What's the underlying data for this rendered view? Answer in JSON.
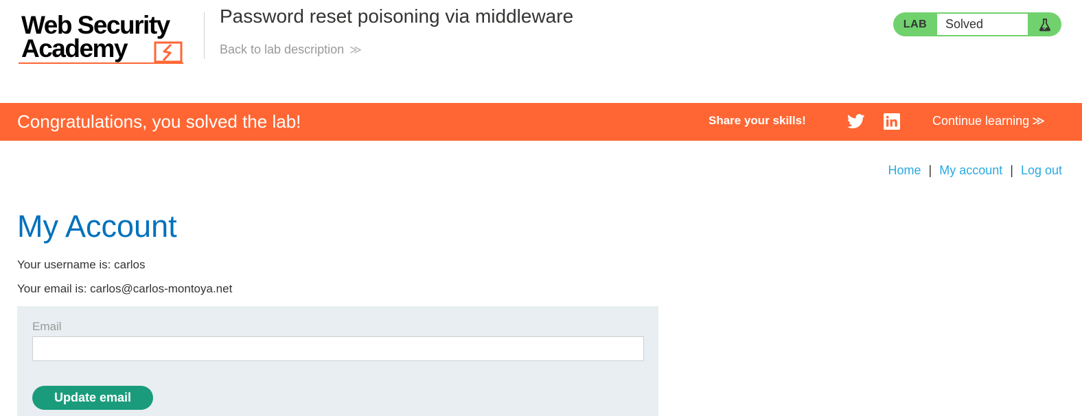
{
  "header": {
    "logo_line1": "Web Security",
    "logo_line2": "Academy",
    "lab_title": "Password reset poisoning via middleware",
    "back_link": "Back to lab description",
    "back_chevron": "≫",
    "lab_badge_label": "LAB",
    "lab_status": "Solved",
    "lab_status_icon": "flask-icon"
  },
  "banner": {
    "message": "Congratulations, you solved the lab!",
    "share_label": "Share your skills!",
    "continue_label": "Continue learning",
    "continue_chevron": "≫",
    "icons": [
      "twitter-icon",
      "linkedin-icon"
    ]
  },
  "nav": {
    "home": "Home",
    "separator": "|",
    "my_account": "My account",
    "log_out": "Log out"
  },
  "main": {
    "title": "My Account",
    "username_line": "Your username is: carlos",
    "email_line": "Your email is: carlos@carlos-montoya.net",
    "form": {
      "email_label": "Email",
      "email_value": "",
      "submit_label": "Update email"
    }
  },
  "colors": {
    "accent_orange": "#ff6633",
    "title_blue": "#0071bc",
    "link_blue": "#29a9e1",
    "solved_green": "#70d16d",
    "button_green": "#1a9c7c",
    "form_bg": "#e8eef1"
  }
}
